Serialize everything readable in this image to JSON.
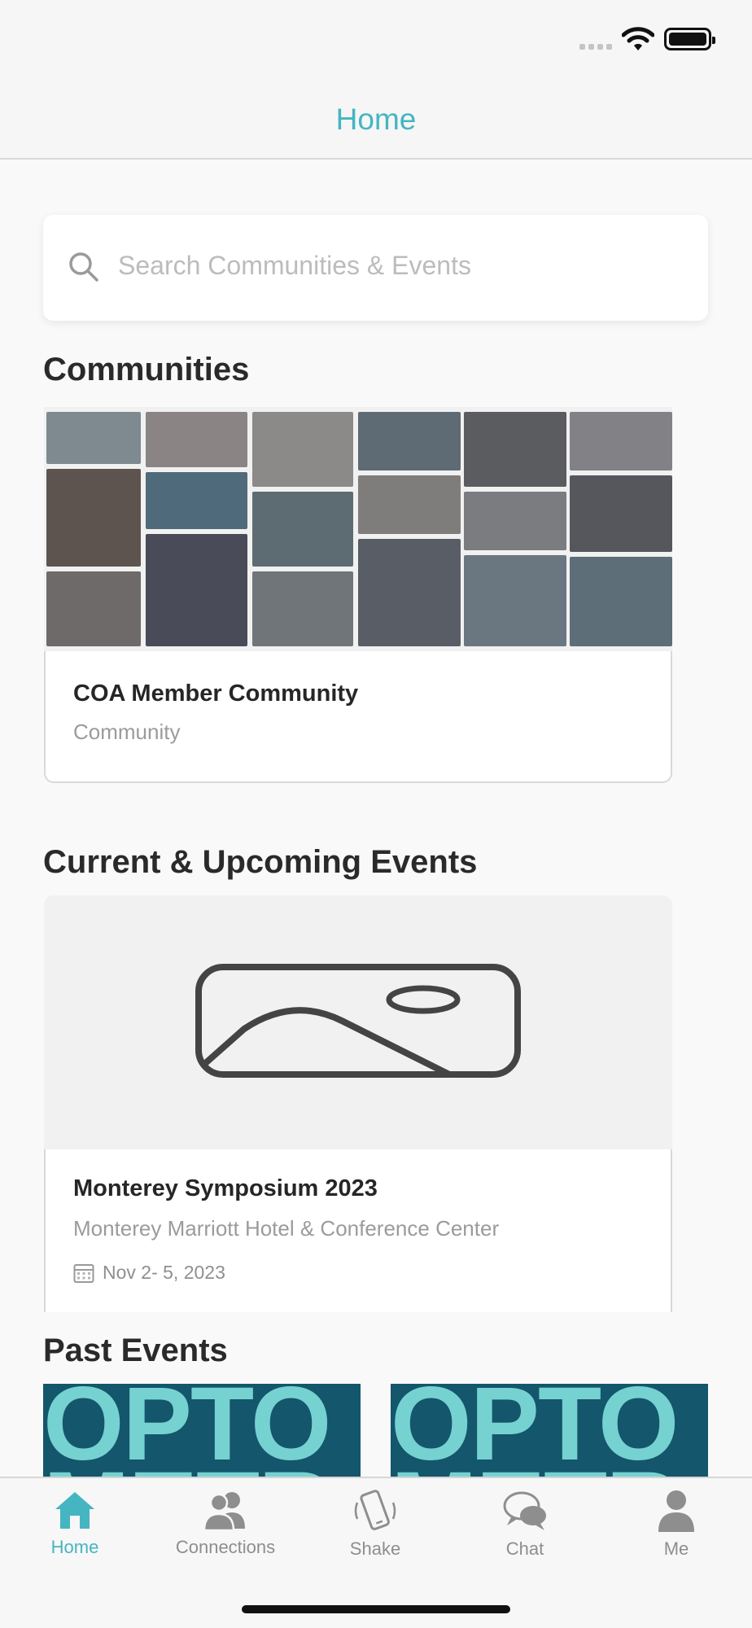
{
  "header": {
    "title": "Home"
  },
  "search": {
    "placeholder": "Search Communities & Events"
  },
  "communities": {
    "heading": "Communities",
    "items": [
      {
        "name": "COA Member Community",
        "type": "Community"
      }
    ]
  },
  "current_events": {
    "heading": "Current & Upcoming Events",
    "items": [
      {
        "name": "Monterey Symposium 2023",
        "venue": "Monterey Marriott Hotel & Conference Center",
        "date": "Nov  2- 5, 2023"
      }
    ]
  },
  "past_events": {
    "heading": "Past Events"
  },
  "tabs": [
    {
      "label": "Home",
      "icon": "home-icon",
      "active": true
    },
    {
      "label": "Connections",
      "icon": "people-icon",
      "active": false
    },
    {
      "label": "Shake",
      "icon": "phone-shake-icon",
      "active": false
    },
    {
      "label": "Chat",
      "icon": "chat-bubble-icon",
      "active": false
    },
    {
      "label": "Me",
      "icon": "person-icon",
      "active": false
    }
  ],
  "colors": {
    "accent": "#45b5c2",
    "past_event_bg": "#14566c",
    "past_event_text": "#76d2d1"
  }
}
